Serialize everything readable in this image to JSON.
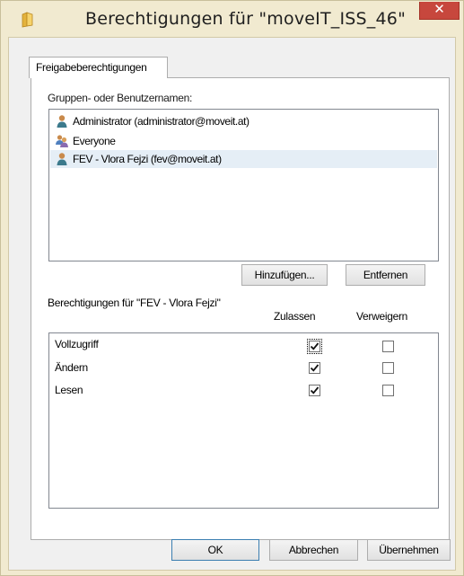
{
  "window": {
    "title": "Berechtigungen für \"moveIT_ISS_46\"",
    "close_glyph": "✕",
    "accent_close": "#c7473d"
  },
  "tab": {
    "label": "Freigabeberechtigungen"
  },
  "groups": {
    "label": "Gruppen- oder Benutzernamen:",
    "items": [
      {
        "name": "Administrator (administrator@moveit.at)",
        "icon": "user-icon",
        "selected": false
      },
      {
        "name": "Everyone",
        "icon": "group-icon",
        "selected": false
      },
      {
        "name": "FEV - Vlora Fejzi (fev@moveit.at)",
        "icon": "user-icon",
        "selected": true
      }
    ],
    "add_label": "Hinzufügen...",
    "remove_label": "Entfernen"
  },
  "permissions": {
    "label": "Berechtigungen für \"FEV - Vlora Fejzi\"",
    "allow_header": "Zulassen",
    "deny_header": "Verweigern",
    "rows": [
      {
        "name": "Vollzugriff",
        "allow": true,
        "deny": false
      },
      {
        "name": "Ändern",
        "allow": true,
        "deny": false
      },
      {
        "name": "Lesen",
        "allow": true,
        "deny": false
      }
    ]
  },
  "footer": {
    "ok_label": "OK",
    "cancel_label": "Abbrechen",
    "apply_label": "Übernehmen"
  }
}
